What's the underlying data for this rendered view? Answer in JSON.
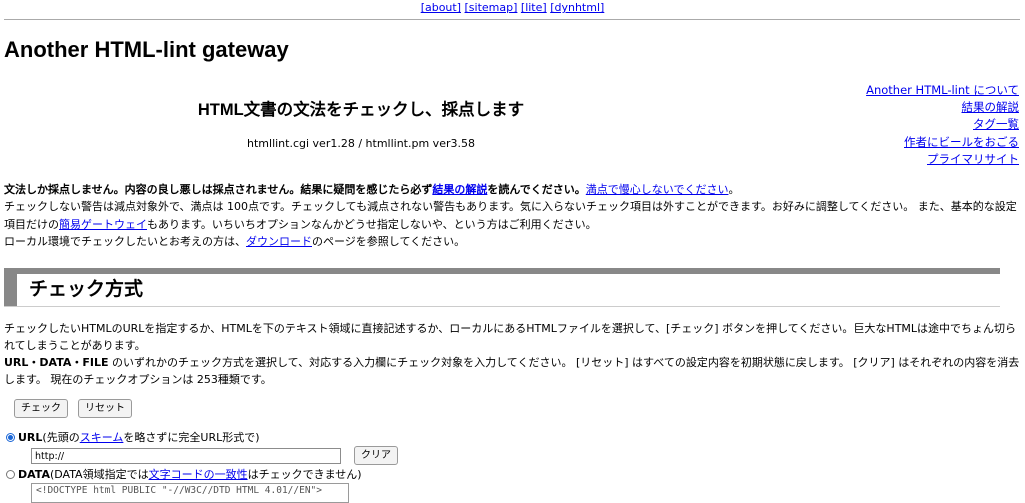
{
  "top_nav": {
    "about": "[about]",
    "sitemap": "[sitemap]",
    "lite": "[lite]",
    "dynhtml": "[dynhtml]"
  },
  "header": {
    "site_title": "Another HTML-lint gateway",
    "subtitle": "HTML文書の文法をチェックし、採点します",
    "version": "htmllint.cgi ver1.28 / htmllint.pm ver3.58"
  },
  "side_menu": {
    "about": "Another HTML-lint について",
    "explanation": "結果の解説",
    "tags": "タグ一覧",
    "beer": "作者にビールをおごる",
    "primary": "プライマリサイト"
  },
  "intro": {
    "p1_bold_a": "文法しか採点しません。内容の良し悪しは採点されません。結果に疑問を感じたら必ず",
    "p1_link": "結果の解説",
    "p1_bold_b": "を読んでください。",
    "p1_link2": "満点で慢心しないでください",
    "p1_end": "。",
    "p2_a": "チェックしない警告は減点対象外で、満点は 100点です。チェックしても減点されない警告もあります。気に入らないチェック項目は外すことができます。お好みに調整してください。 また、基本的な設定項目だけの",
    "p2_link": "簡易ゲートウェイ",
    "p2_b": "もあります。いちいちオプションなんかどうせ指定しないや、という方はご利用ください。",
    "p3_a": "ローカル環境でチェックしたいとお考えの方は、",
    "p3_link": "ダウンロード",
    "p3_b": "のページを参照してください。"
  },
  "section": {
    "title": "チェック方式",
    "p1": "チェックしたいHTMLのURLを指定するか、HTMLを下のテキスト領域に直接記述するか、ローカルにあるHTMLファイルを選択して、[チェック] ボタンを押してください。巨大なHTMLは途中でちょん切られてしまうことがあります。",
    "p2_bold": "URL・DATA・FILE",
    "p2_rest": " のいずれかのチェック方式を選択して、対応する入力欄にチェック対象を入力してください。 [リセット] はすべての設定内容を初期状態に戻します。 [クリア] はそれぞれの内容を消去します。 現在のチェックオプションは 253種類です。"
  },
  "buttons": {
    "check": "チェック",
    "reset": "リセット",
    "clear": "クリア"
  },
  "url_option": {
    "label": "URL",
    "note_a": " (先頭の",
    "note_link": "スキーム",
    "note_b": "を略さずに完全URL形式で)",
    "value": "http://"
  },
  "data_option": {
    "label": "DATA",
    "note_a": " (DATA領域指定では",
    "note_link": "文字コードの一致性",
    "note_b": "はチェックできません)",
    "value": "<!DOCTYPE html PUBLIC \"-//W3C//DTD HTML 4.01//EN\">"
  }
}
